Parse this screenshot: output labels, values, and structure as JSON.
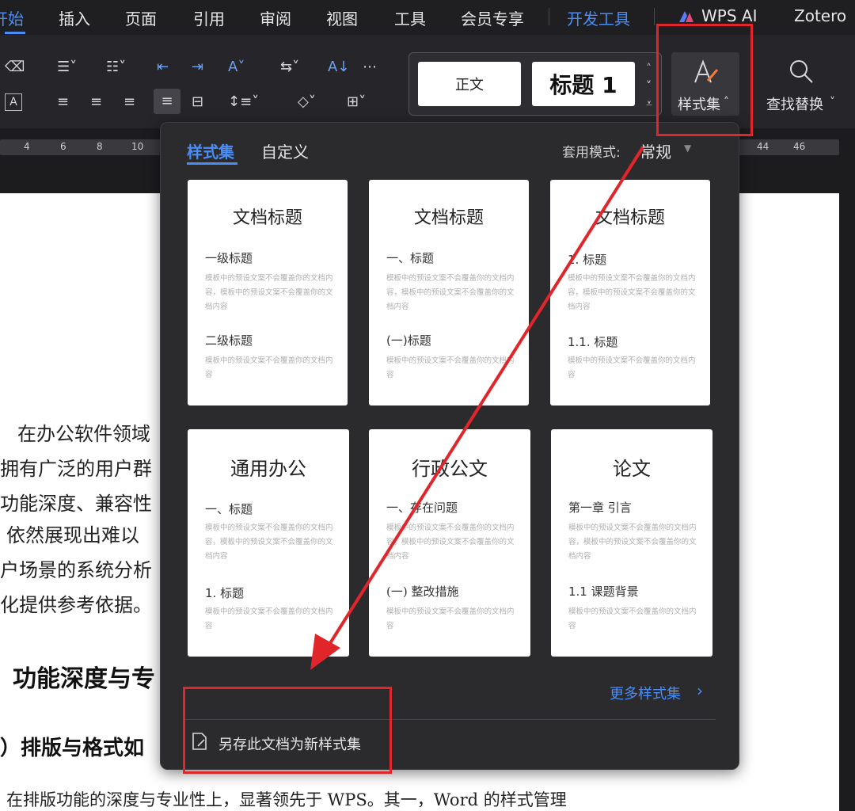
{
  "menubar": {
    "items": [
      "开始",
      "插入",
      "页面",
      "引用",
      "审阅",
      "视图",
      "工具",
      "会员专享",
      "开发工具",
      "WPS AI",
      "Zotero"
    ]
  },
  "ribbon": {
    "style_normal": "正文",
    "style_heading": "标题 1",
    "styleset_label": "样式集",
    "find_replace_label": "查找替换"
  },
  "ruler": {
    "numbers": [
      "4",
      "6",
      "8",
      "10",
      "44",
      "46"
    ]
  },
  "popup": {
    "tab_styleset": "样式集",
    "tab_custom": "自定义",
    "apply_mode_label": "套用模式:",
    "apply_mode_value": "常规",
    "more_link": "更多样式集",
    "save_label": "另存此文档为新样式集",
    "cards": [
      {
        "title": "文档标题",
        "h1": "一级标题",
        "b1": "模板中的预设文案不会覆盖你的文档内容，模板中的预设文案不会覆盖你的文档内容",
        "h2": "二级标题",
        "b2": "模板中的预设文案不会覆盖你的文档内容"
      },
      {
        "title": "文档标题",
        "h1": "一、标题",
        "b1": "模板中的预设文案不会覆盖你的文档内容，模板中的预设文案不会覆盖你的文档内容",
        "h2": "(一)标题",
        "b2": "模板中的预设文案不会覆盖你的文档内容"
      },
      {
        "title": "文档标题",
        "h1": "1. 标题",
        "b1": "模板中的预设文案不会覆盖你的文档内容，模板中的预设文案不会覆盖你的文档内容",
        "h2": "1.1. 标题",
        "b2": "模板中的预设文案不会覆盖你的文档内容"
      },
      {
        "title": "通用办公",
        "h1": "一、标题",
        "b1": "模板中的预设文案不会覆盖你的文档内容，模板中的预设文案不会覆盖你的文档内容",
        "h2": "1. 标题",
        "b2": "模板中的预设文案不会覆盖你的文档内容"
      },
      {
        "title": "行政公文",
        "h1": "一、存在问题",
        "b1": "模板中的预设文案不会覆盖你的文档内容，模板中的预设文案不会覆盖你的文档内容",
        "h2": "(一) 整改措施",
        "b2": "模板中的预设文案不会覆盖你的文档内容"
      },
      {
        "title": "论文",
        "h1": "第一章 引言",
        "b1": "模板中的预设文案不会覆盖你的文档内容，模板中的预设文案不会覆盖你的文档内容",
        "h2": "1.1 课题背景",
        "b2": "模板中的预设文案不会覆盖你的文档内容"
      }
    ]
  },
  "document": {
    "lines": [
      "在办公软件领域",
      "拥有广泛的用户群",
      "功能深度、兼容性",
      "依然展现出难以",
      "户场景的系统分析",
      "化提供参考依据。"
    ],
    "heading1": "功能深度与专",
    "heading2": "）排版与格式如",
    "bottom_line": "在排版功能的深度与专业性上，显著领先于 WPS。其一，Word 的样式管理"
  },
  "colors": {
    "accent": "#4a8df6",
    "annotation_red": "#e0262a",
    "popup_bg": "#2b2b2e"
  }
}
